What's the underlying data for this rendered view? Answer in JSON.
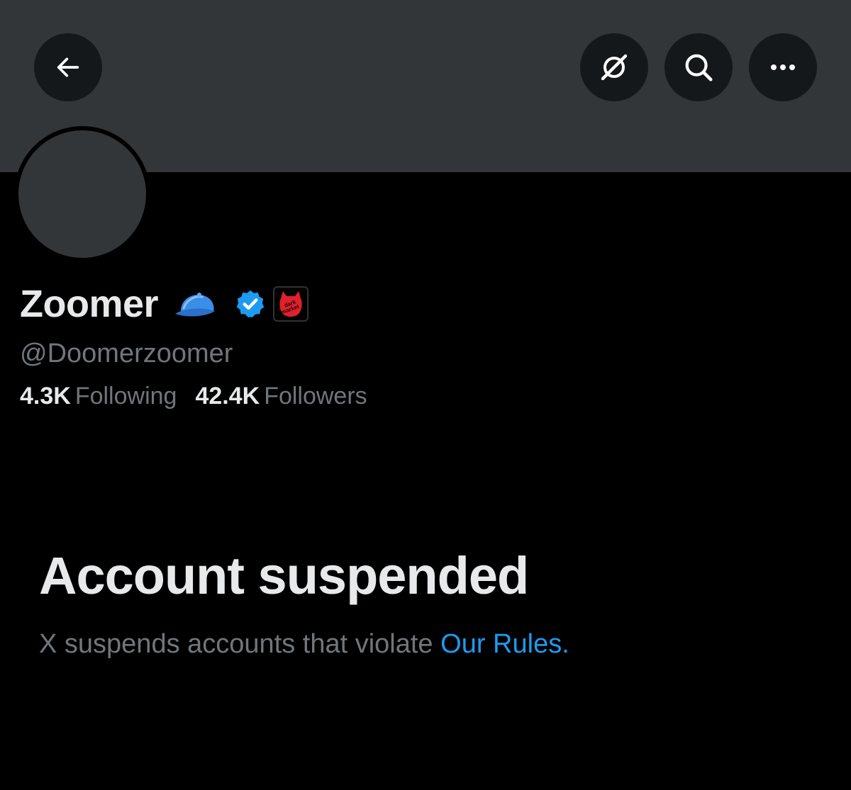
{
  "profile": {
    "display_name": "Zoomer",
    "handle": "@Doomerzoomer",
    "following_count": "4.3K",
    "following_label": "Following",
    "followers_count": "42.4K",
    "followers_label": "Followers",
    "name_emoji": "blue-cap-icon",
    "verified": true,
    "affiliate_badge_text": "dark market"
  },
  "header": {
    "buttons": [
      "back-arrow-icon",
      "grok-icon",
      "search-icon",
      "more-icon"
    ]
  },
  "suspension": {
    "title": "Account suspended",
    "message": "X suspends accounts that violate",
    "link_text": "Our Rules",
    "trailing": "."
  },
  "colors": {
    "background": "#000000",
    "banner": "#333639",
    "button_bg": "#15181b",
    "text_primary": "#e7e9ea",
    "text_secondary": "#71767b",
    "link": "#1d9bf0",
    "verified": "#1d9bf0",
    "badge_red": "#e0212b"
  }
}
